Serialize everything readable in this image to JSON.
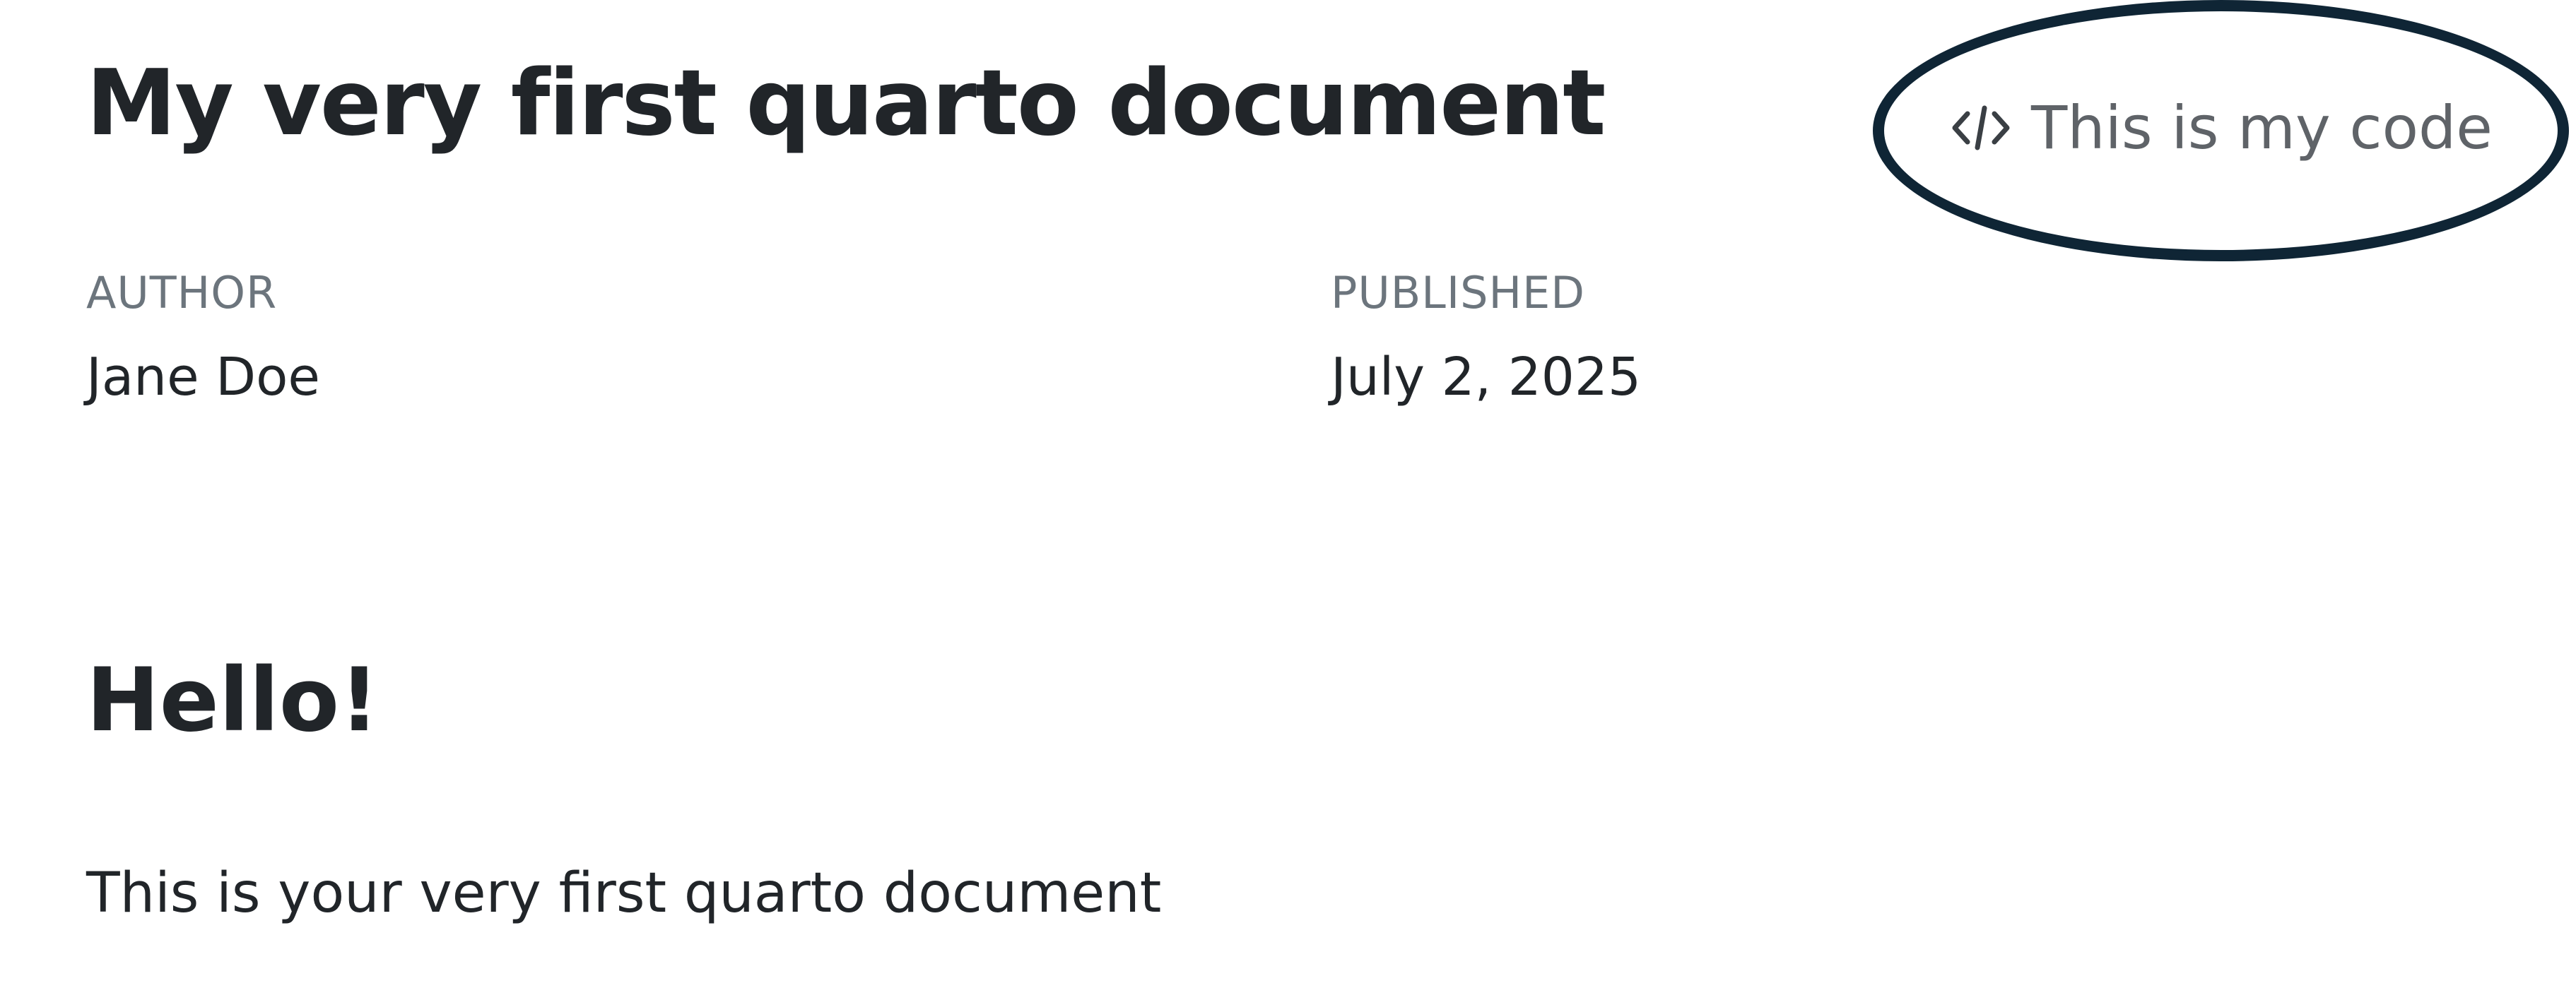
{
  "document": {
    "title": "My very first quarto document",
    "code_tools_label": "This is my code",
    "code_tools_icon": "code-icon",
    "meta": {
      "author_heading": "AUTHOR",
      "author_value": "Jane Doe",
      "published_heading": "PUBLISHED",
      "published_value": "July 2, 2025"
    },
    "section": {
      "heading": "Hello!",
      "body": "This is your very first quarto document"
    }
  },
  "colors": {
    "text": "#212529",
    "muted": "#6c757d",
    "annotation_ring": "#0f2535"
  }
}
